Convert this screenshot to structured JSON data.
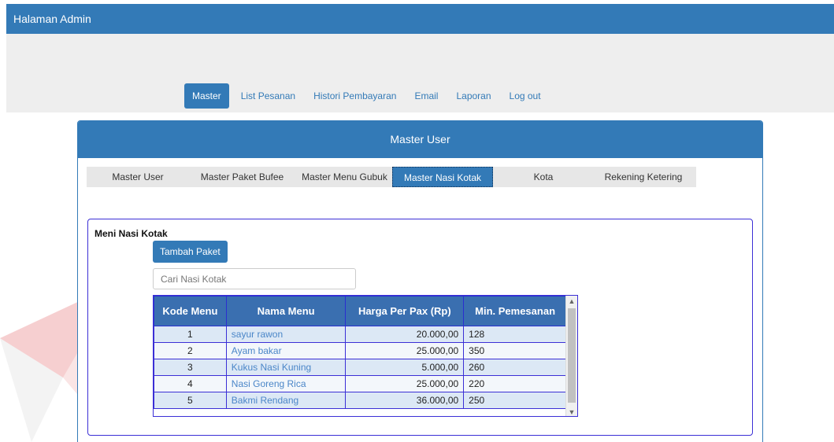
{
  "app": {
    "title": "Halaman Admin"
  },
  "nav": [
    {
      "label": "Master",
      "active": true
    },
    {
      "label": "List Pesanan",
      "active": false
    },
    {
      "label": "Histori Pembayaran",
      "active": false
    },
    {
      "label": "Email",
      "active": false
    },
    {
      "label": "Laporan",
      "active": false
    },
    {
      "label": "Log out",
      "active": false
    }
  ],
  "panel": {
    "title": "Master User"
  },
  "tabs": [
    {
      "label": "Master User",
      "active": false
    },
    {
      "label": "Master Paket Bufee",
      "active": false
    },
    {
      "label": "Master Menu Gubuk",
      "active": false
    },
    {
      "label": "Master Nasi Kotak",
      "active": true
    },
    {
      "label": "Kota",
      "active": false
    },
    {
      "label": "Rekening Ketering",
      "active": false
    }
  ],
  "section": {
    "title": "Meni Nasi Kotak",
    "add_button": "Tambah Paket",
    "search_placeholder": "Cari Nasi Kotak"
  },
  "table": {
    "headers": [
      "Kode Menu",
      "Nama Menu",
      "Harga Per Pax (Rp)",
      "Min. Pemesanan"
    ],
    "rows": [
      {
        "kode": "1",
        "nama": "sayur rawon",
        "harga": "20.000,00",
        "min": "128"
      },
      {
        "kode": "2",
        "nama": "Ayam bakar",
        "harga": "25.000,00",
        "min": "350"
      },
      {
        "kode": "3",
        "nama": "Kukus Nasi Kuning",
        "harga": "5.000,00",
        "min": "260"
      },
      {
        "kode": "4",
        "nama": "Nasi Goreng Rica",
        "harga": "25.000,00",
        "min": "220"
      },
      {
        "kode": "5",
        "nama": "Bakmi Rendang",
        "harga": "36.000,00",
        "min": "250"
      }
    ]
  },
  "colors": {
    "primary": "#337ab7",
    "table_border": "#3b2fd6",
    "watermark_red": "#d8262b"
  },
  "icons": {
    "scroll_up": "chevron-up-icon",
    "scroll_down": "chevron-down-icon"
  }
}
